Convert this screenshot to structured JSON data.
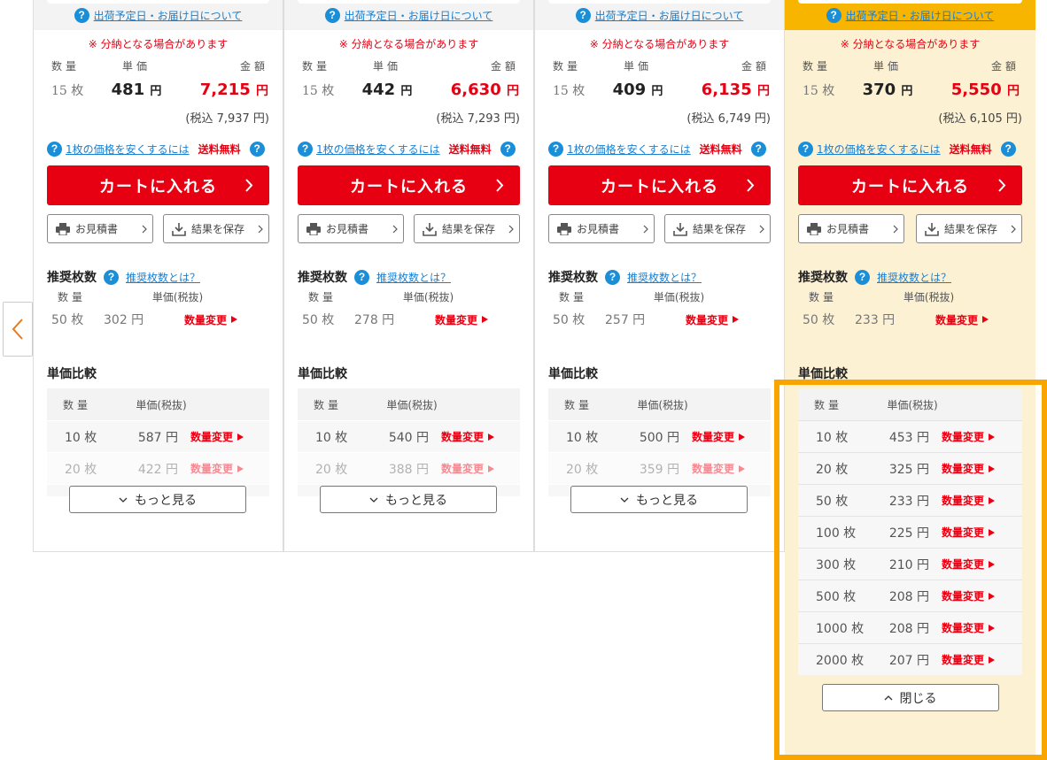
{
  "columns": [
    {
      "top_link": "出荷予定日・お届け日について",
      "note": "※ 分納となる場合があります",
      "labels": {
        "qty": "数量",
        "unit": "単価",
        "amount": "金額"
      },
      "qty": "15 枚",
      "unit_price": "481",
      "amount": "7,215",
      "yen": "円",
      "tax_incl": "(税込 7,937 円)",
      "cheaper_link": "1枚の価格を安くするには",
      "free_ship": "送料無料",
      "cart_label": "カートに入れる",
      "quote_label": "お見積書",
      "save_label": "結果を保存",
      "rec_title": "推奨枚数",
      "rec_link": "推奨枚数とは？",
      "rec_hdr_qty": "数量",
      "rec_hdr_unit": "単価(税抜)",
      "rec_qty": "50 枚",
      "rec_unit": "302 円",
      "change_label": "数量変更",
      "cmp_title": "単価比較",
      "cmp_hdr_qty": "数量",
      "cmp_hdr_unit": "単価(税抜)",
      "rows": [
        {
          "qty": "10 枚",
          "unit": "587 円"
        },
        {
          "qty": "20 枚",
          "unit": "422 円"
        }
      ],
      "more_label": "もっと見る"
    },
    {
      "top_link": "出荷予定日・お届け日について",
      "note": "※ 分納となる場合があります",
      "labels": {
        "qty": "数量",
        "unit": "単価",
        "amount": "金額"
      },
      "qty": "15 枚",
      "unit_price": "442",
      "amount": "6,630",
      "yen": "円",
      "tax_incl": "(税込 7,293 円)",
      "cheaper_link": "1枚の価格を安くするには",
      "free_ship": "送料無料",
      "cart_label": "カートに入れる",
      "quote_label": "お見積書",
      "save_label": "結果を保存",
      "rec_title": "推奨枚数",
      "rec_link": "推奨枚数とは？",
      "rec_hdr_qty": "数量",
      "rec_hdr_unit": "単価(税抜)",
      "rec_qty": "50 枚",
      "rec_unit": "278 円",
      "change_label": "数量変更",
      "cmp_title": "単価比較",
      "cmp_hdr_qty": "数量",
      "cmp_hdr_unit": "単価(税抜)",
      "rows": [
        {
          "qty": "10 枚",
          "unit": "540 円"
        },
        {
          "qty": "20 枚",
          "unit": "388 円"
        }
      ],
      "more_label": "もっと見る"
    },
    {
      "top_link": "出荷予定日・お届け日について",
      "note": "※ 分納となる場合があります",
      "labels": {
        "qty": "数量",
        "unit": "単価",
        "amount": "金額"
      },
      "qty": "15 枚",
      "unit_price": "409",
      "amount": "6,135",
      "yen": "円",
      "tax_incl": "(税込 6,749 円)",
      "cheaper_link": "1枚の価格を安くするには",
      "free_ship": "送料無料",
      "cart_label": "カートに入れる",
      "quote_label": "お見積書",
      "save_label": "結果を保存",
      "rec_title": "推奨枚数",
      "rec_link": "推奨枚数とは？",
      "rec_hdr_qty": "数量",
      "rec_hdr_unit": "単価(税抜)",
      "rec_qty": "50 枚",
      "rec_unit": "257 円",
      "change_label": "数量変更",
      "cmp_title": "単価比較",
      "cmp_hdr_qty": "数量",
      "cmp_hdr_unit": "単価(税抜)",
      "rows": [
        {
          "qty": "10 枚",
          "unit": "500 円"
        },
        {
          "qty": "20 枚",
          "unit": "359 円"
        }
      ],
      "more_label": "もっと見る"
    },
    {
      "top_link": "出荷予定日・お届け日について",
      "note": "※ 分納となる場合があります",
      "labels": {
        "qty": "数量",
        "unit": "単価",
        "amount": "金額"
      },
      "qty": "15 枚",
      "unit_price": "370",
      "amount": "5,550",
      "yen": "円",
      "tax_incl": "(税込 6,105 円)",
      "cheaper_link": "1枚の価格を安くするには",
      "free_ship": "送料無料",
      "cart_label": "カートに入れる",
      "quote_label": "お見積書",
      "save_label": "結果を保存",
      "rec_title": "推奨枚数",
      "rec_link": "推奨枚数とは？",
      "rec_hdr_qty": "数量",
      "rec_hdr_unit": "単価(税抜)",
      "rec_qty": "50 枚",
      "rec_unit": "233 円",
      "change_label": "数量変更",
      "cmp_title": "単価比較",
      "cmp_hdr_qty": "数量",
      "cmp_hdr_unit": "単価(税抜)",
      "rows": [
        {
          "qty": "10 枚",
          "unit": "453 円"
        },
        {
          "qty": "20 枚",
          "unit": "325 円"
        },
        {
          "qty": "50 枚",
          "unit": "233 円"
        },
        {
          "qty": "100 枚",
          "unit": "225 円"
        },
        {
          "qty": "300 枚",
          "unit": "210 円"
        },
        {
          "qty": "500 枚",
          "unit": "208 円"
        },
        {
          "qty": "1000 枚",
          "unit": "208 円"
        },
        {
          "qty": "2000 枚",
          "unit": "207 円"
        }
      ],
      "close_label": "閉じる"
    }
  ],
  "colors": {
    "accent": "#e60012",
    "highlight": "#f8b500",
    "link": "#1a7fd0"
  }
}
